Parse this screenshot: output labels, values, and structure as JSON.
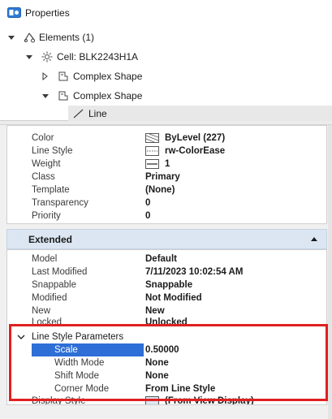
{
  "window": {
    "title": "Properties"
  },
  "tree": {
    "items": [
      {
        "label": "Elements (1)",
        "icon": "elements-icon",
        "expander": "expanded"
      },
      {
        "label": "Cell: BLK2243H1A",
        "icon": "cell-icon",
        "expander": "expanded"
      },
      {
        "label": "Complex Shape",
        "icon": "complex-shape-icon",
        "expander": "collapsed"
      },
      {
        "label": "Complex Shape",
        "icon": "complex-shape-icon",
        "expander": "expanded"
      },
      {
        "label": "Line",
        "icon": "line-icon",
        "expander": "none"
      }
    ]
  },
  "general": {
    "rows": [
      {
        "name": "Color",
        "value": "ByLevel (227)",
        "swatch": "color-swatch-icon"
      },
      {
        "name": "Line Style",
        "value": "rw-ColorEase",
        "swatch": "linestyle-swatch-icon"
      },
      {
        "name": "Weight",
        "value": "1",
        "swatch": "weight-swatch-icon"
      },
      {
        "name": "Class",
        "value": "Primary"
      },
      {
        "name": "Template",
        "value": "(None)"
      },
      {
        "name": "Transparency",
        "value": "0"
      },
      {
        "name": "Priority",
        "value": "0"
      }
    ]
  },
  "extended": {
    "title": "Extended",
    "rows": [
      {
        "name": "Model",
        "value": "Default"
      },
      {
        "name": "Last Modified",
        "value": "7/11/2023 10:02:54 AM"
      },
      {
        "name": "Snappable",
        "value": "Snappable"
      },
      {
        "name": "Modified",
        "value": "Not Modified"
      },
      {
        "name": "New",
        "value": "New"
      },
      {
        "name": "Locked",
        "value": "Unlocked"
      }
    ],
    "line_style_parameters": {
      "title": "Line Style Parameters",
      "rows": [
        {
          "name": "Scale",
          "value": "0.50000",
          "selected": true
        },
        {
          "name": "Width Mode",
          "value": "None"
        },
        {
          "name": "Shift Mode",
          "value": "None"
        },
        {
          "name": "Corner Mode",
          "value": "From Line Style"
        }
      ]
    },
    "display_style": {
      "name": "Display Style",
      "value": "(From View Display)"
    }
  },
  "colors": {
    "highlight": "#e02020",
    "selection": "#2d6fd6",
    "section_header": "#dbe6f2"
  }
}
